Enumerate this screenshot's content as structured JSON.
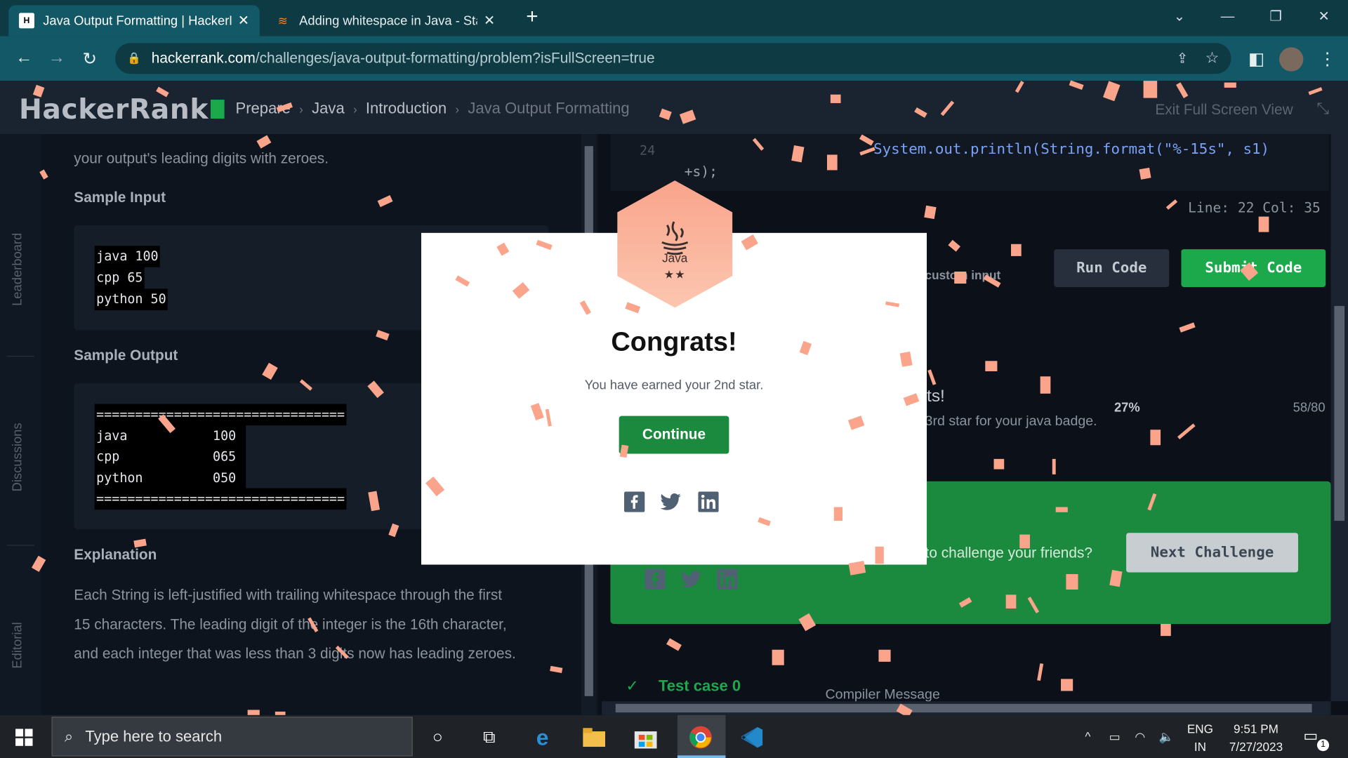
{
  "browser": {
    "tabs": [
      {
        "title": "Java Output Formatting | HackerR",
        "favicon": "hackerrank-icon",
        "active": true
      },
      {
        "title": "Adding whitespace in Java - Stack",
        "favicon": "stackoverflow-icon",
        "active": false
      }
    ],
    "url_host": "hackerrank.com",
    "url_path": "/challenges/java-output-formatting/problem?isFullScreen=true"
  },
  "header": {
    "logo": "HackerRank",
    "breadcrumbs": [
      "Prepare",
      "Java",
      "Introduction",
      "Java Output Formatting"
    ],
    "exit_fullscreen": "Exit Full Screen View"
  },
  "sidebar_tabs": [
    "Leaderboard",
    "Discussions",
    "Editorial"
  ],
  "problem": {
    "intro_text": "your output's leading digits with zeroes.",
    "sample_input_heading": "Sample Input",
    "sample_input": [
      "java 100",
      "cpp 65",
      "python 50"
    ],
    "sample_output_heading": "Sample Output",
    "sample_output": [
      "================================",
      "java           100 ",
      "cpp            065 ",
      "python         050 ",
      "================================"
    ],
    "explanation_heading": "Explanation",
    "explanation_lines": [
      "Each String is left-justified with trailing whitespace through the first",
      "15 characters. The leading digit of the integer is the 16th character,",
      "and each integer that was less than 3 digits now has leading zeroes."
    ]
  },
  "editor": {
    "line_number": "24",
    "code_line": "System.out.println(String.format(\"%-15s\", s1)",
    "code_fragment": "+s);",
    "status": "Line: 22  Col: 35",
    "custom_input": "custom input",
    "run_code": "Run Code",
    "submit_code": "Submit Code"
  },
  "result_panel": {
    "congrats_partial": "ts!",
    "next_star_text": "3rd star for your java badge.",
    "progress_percent": "27%",
    "progress_count": "58/80",
    "challenge_friends": "to challenge your friends?",
    "next_challenge": "Next Challenge",
    "test_case": "Test case 0",
    "compiler_message": "Compiler Message"
  },
  "modal": {
    "badge_label": "Java",
    "badge_stars": "★★",
    "title": "Congrats!",
    "message": "You have earned your 2nd star.",
    "continue_label": "Continue"
  },
  "taskbar": {
    "search_placeholder": "Type here to search",
    "lang_top": "ENG",
    "lang_bottom": "IN",
    "time": "9:51 PM",
    "date": "7/27/2023",
    "notification_count": "1"
  },
  "colors": {
    "accent_green": "#1ba94c",
    "badge_salmon": "#f9a48b",
    "tab_bar": "#0e3a44",
    "address_bar": "#135866"
  }
}
